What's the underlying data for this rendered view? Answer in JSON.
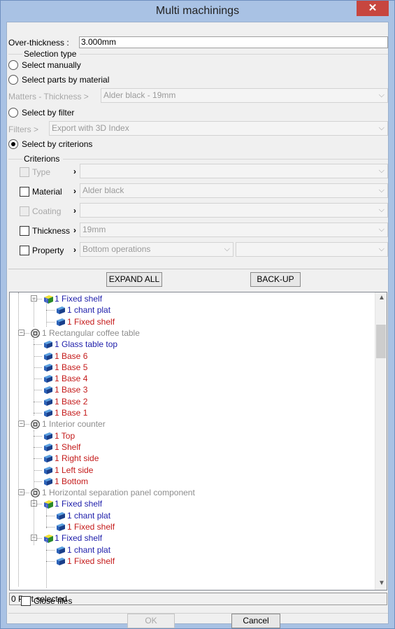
{
  "window": {
    "title": "Multi machinings",
    "close_glyph": "✕"
  },
  "overthickness": {
    "label": "Over-thickness :",
    "value": "3.000mm"
  },
  "selection_type": {
    "label": "Selection type",
    "manual": "Select manually",
    "material": "Select parts by material",
    "matters_label": "Matters - Thickness >",
    "matters_value": "Alder black - 19mm",
    "filter": "Select by filter",
    "filters_label": "Filters >",
    "filters_value": "Export with 3D Index",
    "criterions": "Select by criterions",
    "selected": "criterions"
  },
  "criterions": {
    "label": "Criterions",
    "rows": [
      {
        "label": "Type",
        "value": ""
      },
      {
        "label": "Material",
        "value": "Alder black"
      },
      {
        "label": "Coating",
        "value": ""
      },
      {
        "label": "Thickness",
        "value": "19mm"
      },
      {
        "label": "Property",
        "value": "Bottom operations"
      }
    ]
  },
  "buttons": {
    "expand_all": "EXPAND ALL",
    "back_up": "BACK-UP",
    "ok": "OK",
    "cancel": "Cancel"
  },
  "tree": [
    {
      "label": "1 Fixed shelf",
      "level": 1,
      "color": "blue",
      "icon": "cube-icon"
    },
    {
      "label": "1 chant plat",
      "level": 2,
      "color": "blue",
      "icon": "part-icon"
    },
    {
      "label": "1 Fixed shelf",
      "level": 2,
      "color": "red",
      "icon": "part-icon"
    },
    {
      "label": "1 Rectangular coffee table",
      "level": 0,
      "color": "gray",
      "icon": "assembly-icon"
    },
    {
      "label": "1 Glass table top",
      "level": 1,
      "color": "blue",
      "icon": "part-icon"
    },
    {
      "label": "1 Base 6",
      "level": 1,
      "color": "red",
      "icon": "part-icon"
    },
    {
      "label": "1 Base 5",
      "level": 1,
      "color": "red",
      "icon": "part-icon"
    },
    {
      "label": "1 Base 4",
      "level": 1,
      "color": "red",
      "icon": "part-icon"
    },
    {
      "label": "1 Base 3",
      "level": 1,
      "color": "red",
      "icon": "part-icon"
    },
    {
      "label": "1 Base 2",
      "level": 1,
      "color": "red",
      "icon": "part-icon"
    },
    {
      "label": "1 Base 1",
      "level": 1,
      "color": "red",
      "icon": "part-icon"
    },
    {
      "label": "1 Interior counter",
      "level": 0,
      "color": "gray",
      "icon": "assembly-icon"
    },
    {
      "label": "1 Top",
      "level": 1,
      "color": "red",
      "icon": "part-icon"
    },
    {
      "label": "1 Shelf",
      "level": 1,
      "color": "red",
      "icon": "part-icon"
    },
    {
      "label": "1 Right side",
      "level": 1,
      "color": "red",
      "icon": "part-icon"
    },
    {
      "label": "1 Left side",
      "level": 1,
      "color": "red",
      "icon": "part-icon"
    },
    {
      "label": "1 Bottom",
      "level": 1,
      "color": "red",
      "icon": "part-icon"
    },
    {
      "label": "1 Horizontal separation panel component",
      "level": 0,
      "color": "gray",
      "icon": "assembly-icon"
    },
    {
      "label": "1 Fixed shelf",
      "level": 1,
      "color": "blue",
      "icon": "cube-icon"
    },
    {
      "label": "1 chant plat",
      "level": 2,
      "color": "blue",
      "icon": "part-icon"
    },
    {
      "label": "1 Fixed shelf",
      "level": 2,
      "color": "red",
      "icon": "part-icon"
    },
    {
      "label": "1 Fixed shelf",
      "level": 1,
      "color": "blue",
      "icon": "cube-icon"
    },
    {
      "label": "1 chant plat",
      "level": 2,
      "color": "blue",
      "icon": "part-icon"
    },
    {
      "label": "1 Fixed shelf",
      "level": 2,
      "color": "red",
      "icon": "part-icon"
    }
  ],
  "status": "0 Part selected",
  "close_files": "Close files",
  "colors": {
    "titlebar": "#a9c2e4",
    "close": "#c7463f",
    "blue": "#1d1daa",
    "red": "#c41a1a"
  }
}
